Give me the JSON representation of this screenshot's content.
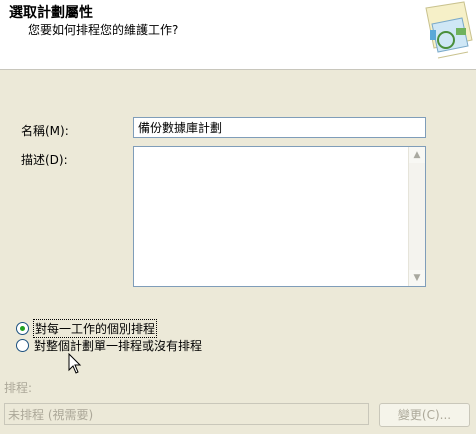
{
  "header": {
    "title": "選取計劃屬性",
    "subtitle": "您要如何排程您的維護工作?"
  },
  "form": {
    "name_label": "名稱(M):",
    "name_value": "備份數據庫計劃",
    "description_label": "描述(D):",
    "description_value": ""
  },
  "schedule_options": [
    {
      "label": "對每一工作的個別排程",
      "selected": true
    },
    {
      "label": "對整個計劃單一排程或沒有排程",
      "selected": false
    }
  ],
  "schedule": {
    "label": "排程:",
    "value": "未排程 (視需要)",
    "change_button": "變更(C)..."
  },
  "icons": [
    "wizard-header-icon",
    "scroll-up-icon",
    "scroll-down-icon",
    "mouse-pointer-icon"
  ],
  "colors": {
    "background": "#ece9d8",
    "input_border": "#7f9db9",
    "radio_dot": "#21a121",
    "disabled_text": "#aca899"
  }
}
